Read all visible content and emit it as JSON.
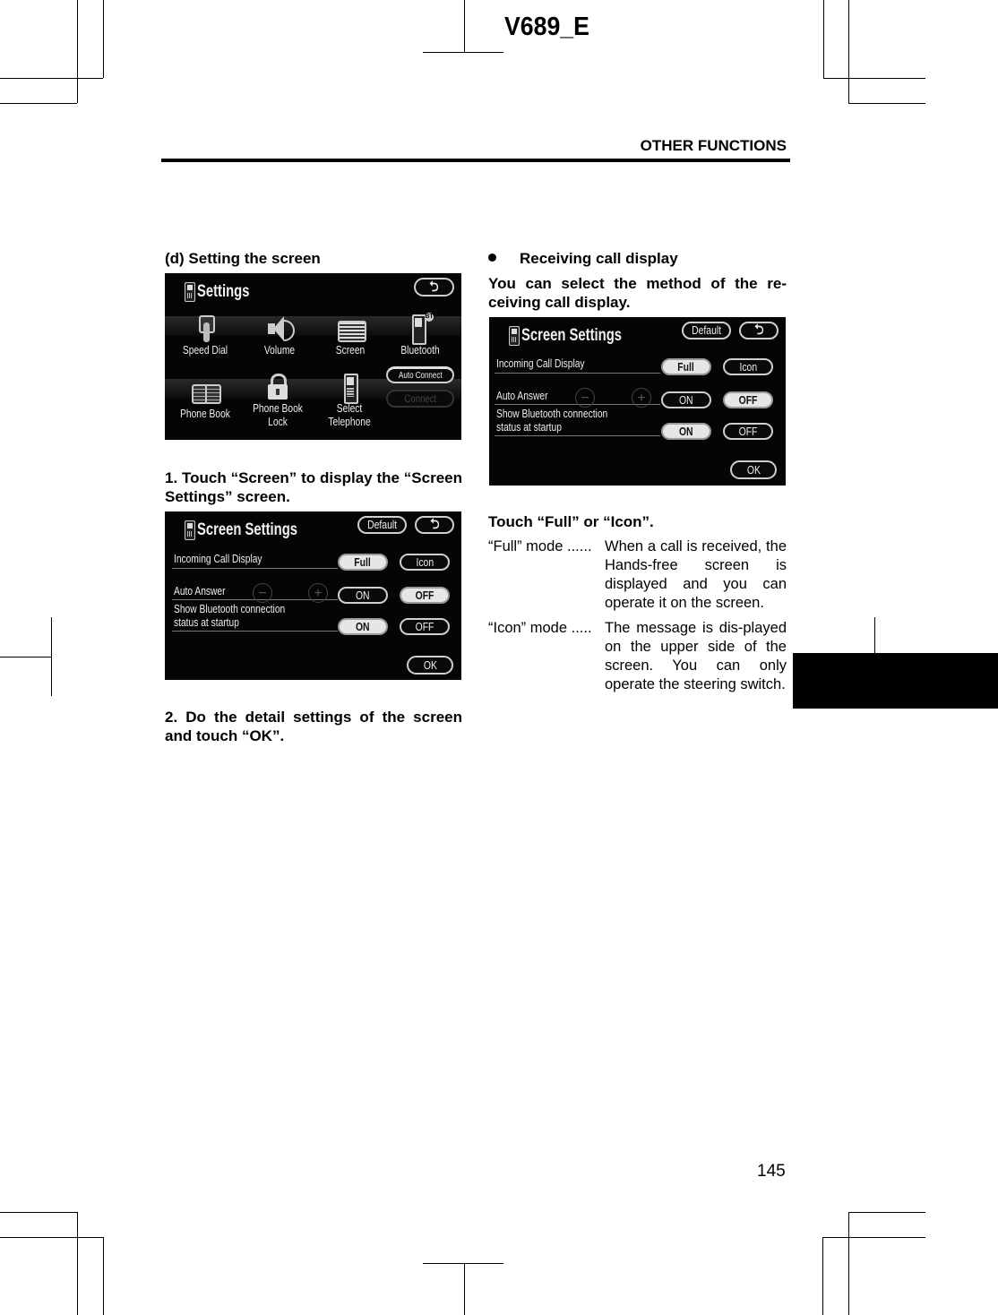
{
  "header": {
    "doc_code": "V689_E",
    "section_title": "OTHER FUNCTIONS"
  },
  "page_number": "145",
  "left_column": {
    "heading": "(d)  Setting the screen",
    "settings_screen": {
      "title": "Settings",
      "back_icon": "back-arrow-icon",
      "items": [
        {
          "label": "Speed Dial",
          "icon": "speed-dial-icon"
        },
        {
          "label": "Volume",
          "icon": "speaker-icon"
        },
        {
          "label": "Screen",
          "icon": "screen-icon"
        },
        {
          "label": "Bluetooth",
          "icon": "bluetooth-phone-icon"
        },
        {
          "label": "Phone Book",
          "icon": "book-icon"
        },
        {
          "label": "Phone Book",
          "label2": "Lock",
          "icon": "lock-icon"
        },
        {
          "label": "Select",
          "label2": "Telephone",
          "icon": "telephone-icon"
        }
      ],
      "auto_connect_label": "Auto Connect",
      "connect_label": "Connect"
    },
    "step1": "1.  Touch “Screen” to display the “Screen Settings” screen.",
    "step2": "2.  Do the detail settings of the screen and touch “OK”."
  },
  "screen_settings": {
    "title": "Screen Settings",
    "default_label": "Default",
    "rows": [
      {
        "label": "Incoming Call Display",
        "options": [
          "Full",
          "Icon"
        ],
        "selected": "Full"
      },
      {
        "label": "Auto Answer",
        "options": [
          "ON",
          "OFF"
        ],
        "selected": "OFF",
        "minus": "−",
        "plus": "+"
      },
      {
        "label": "Show Bluetooth connection",
        "label2": "status at startup",
        "options": [
          "ON",
          "OFF"
        ],
        "selected": "ON"
      }
    ],
    "ok_label": "OK"
  },
  "right_column": {
    "heading": "Receiving call display",
    "intro": "You can select the method of the re-ceiving call display.",
    "instruction": "Touch “Full” or “Icon”.",
    "modes": [
      {
        "term": "“Full” mode ......",
        "desc": "When a call is received, the Hands-free screen is displayed and you can operate it on the screen."
      },
      {
        "term": "“Icon” mode .....",
        "desc": "The message is dis-played on the upper side of the screen. You can only operate the steering switch."
      }
    ]
  }
}
